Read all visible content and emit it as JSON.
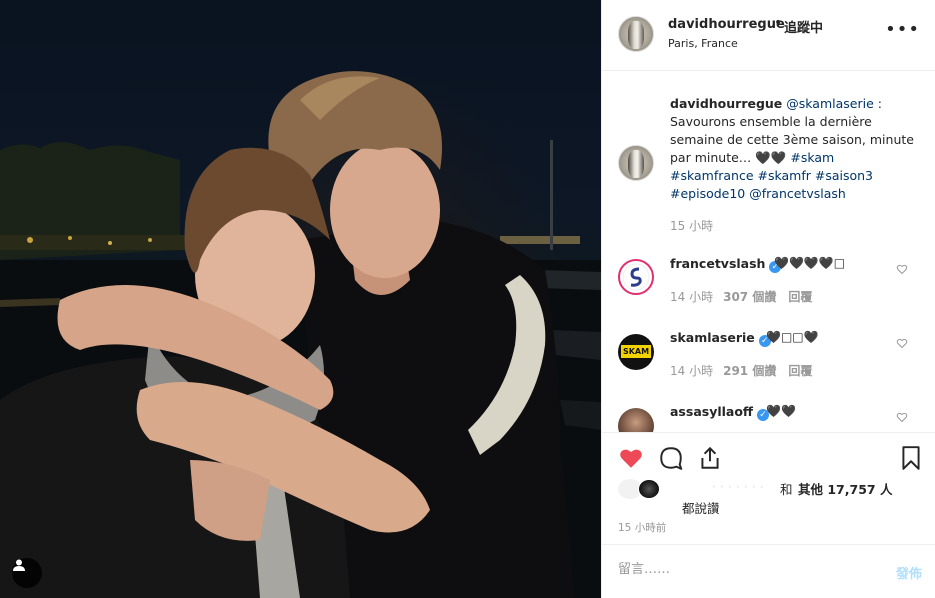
{
  "header": {
    "username": "davidhourregue",
    "separator": "•",
    "follow_status": "追蹤中",
    "location": "Paris, France",
    "more_icon": "more-horizontal-icon"
  },
  "caption": {
    "username": "davidhourregue",
    "mention": "@skamlaserie",
    "text": " : Savourons ensemble la dernière semaine de cette 3ème saison, minute par minute… 🖤🖤 ",
    "hashtags": "#skam #skamfrance #skamfr #saison3 #episode10",
    "mention2": "@francetvslash",
    "time": "15 小時"
  },
  "comments": [
    {
      "username": "francetvslash",
      "verified": true,
      "text": "🖤🖤🖤🖤□",
      "time": "14 小時",
      "likes": "307 個讚",
      "reply": "回覆"
    },
    {
      "username": "skamlaserie",
      "verified": true,
      "text": "🖤□□🖤",
      "time": "14 小時",
      "likes": "291 個讚",
      "reply": "回覆"
    },
    {
      "username": "assasyllaoff",
      "verified": true,
      "text": "🖤🖤",
      "time": "",
      "likes": "",
      "reply": ""
    }
  ],
  "skam_logo_text": "SKAM",
  "likes": {
    "blurred_names": "· · · · · · ·",
    "and": "和",
    "others": "其他 17,757 人",
    "liked": "都說讚"
  },
  "timestamp": "15 小時前",
  "add_comment": {
    "placeholder": "留言……",
    "post_label": "發佈"
  },
  "colors": {
    "like_red": "#ed4956",
    "link_blue": "#003569",
    "verified_blue": "#3897f0",
    "post_disabled": "#b2dffc"
  }
}
